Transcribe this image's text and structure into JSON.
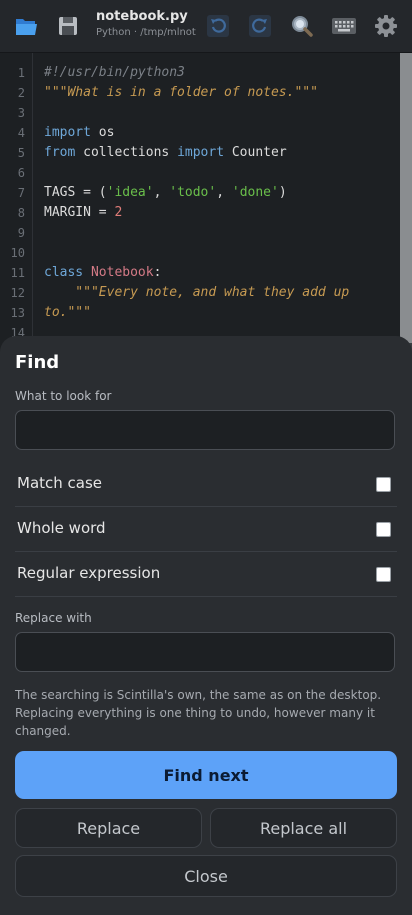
{
  "toolbar": {
    "file_title": "notebook.py",
    "file_subtitle": "Python · /tmp/mlnotes",
    "icons": [
      "open-folder-icon",
      "save-icon",
      "undo-icon",
      "redo-icon",
      "search-icon",
      "keyboard-icon",
      "gear-icon"
    ]
  },
  "editor": {
    "line_numbers": [
      "1",
      "2",
      "3",
      "4",
      "5",
      "6",
      "7",
      "8",
      "9",
      "10",
      "11",
      "12",
      "13",
      "14"
    ],
    "lines": {
      "l1": "#!/usr/bin/python3",
      "l2": "\"\"\"What is in a folder of notes.\"\"\"",
      "l4_kw": "import",
      "l4_rest": " os",
      "l5_kw1": "from",
      "l5_mid": " collections ",
      "l5_kw2": "import",
      "l5_rest": " Counter",
      "l7_a": "TAGS = (",
      "l7_s1": "'idea'",
      "l7_c1": ", ",
      "l7_s2": "'todo'",
      "l7_c2": ", ",
      "l7_s3": "'done'",
      "l7_end": ")",
      "l8_a": "MARGIN = ",
      "l8_num": "2",
      "l11_kw": "class",
      "l11_sp": " ",
      "l11_name": "Notebook",
      "l11_end": ":",
      "l12": "    \"\"\"Every note, and what they add up",
      "l13": "to.\"\"\""
    }
  },
  "find": {
    "title": "Find",
    "search_label": "What to look for",
    "search_value": "",
    "options": {
      "match_case": "Match case",
      "whole_word": "Whole word",
      "regex": "Regular expression"
    },
    "replace_label": "Replace with",
    "replace_value": "",
    "hint": "The searching is Scintilla's own, the same as on the desktop. Replacing everything is one thing to undo, however many it changed.",
    "find_next": "Find next",
    "replace": "Replace",
    "replace_all": "Replace all",
    "close": "Close"
  },
  "colors": {
    "accent": "#5da2f8",
    "sheet_bg": "#2a2d31",
    "editor_bg": "#1d2023"
  }
}
